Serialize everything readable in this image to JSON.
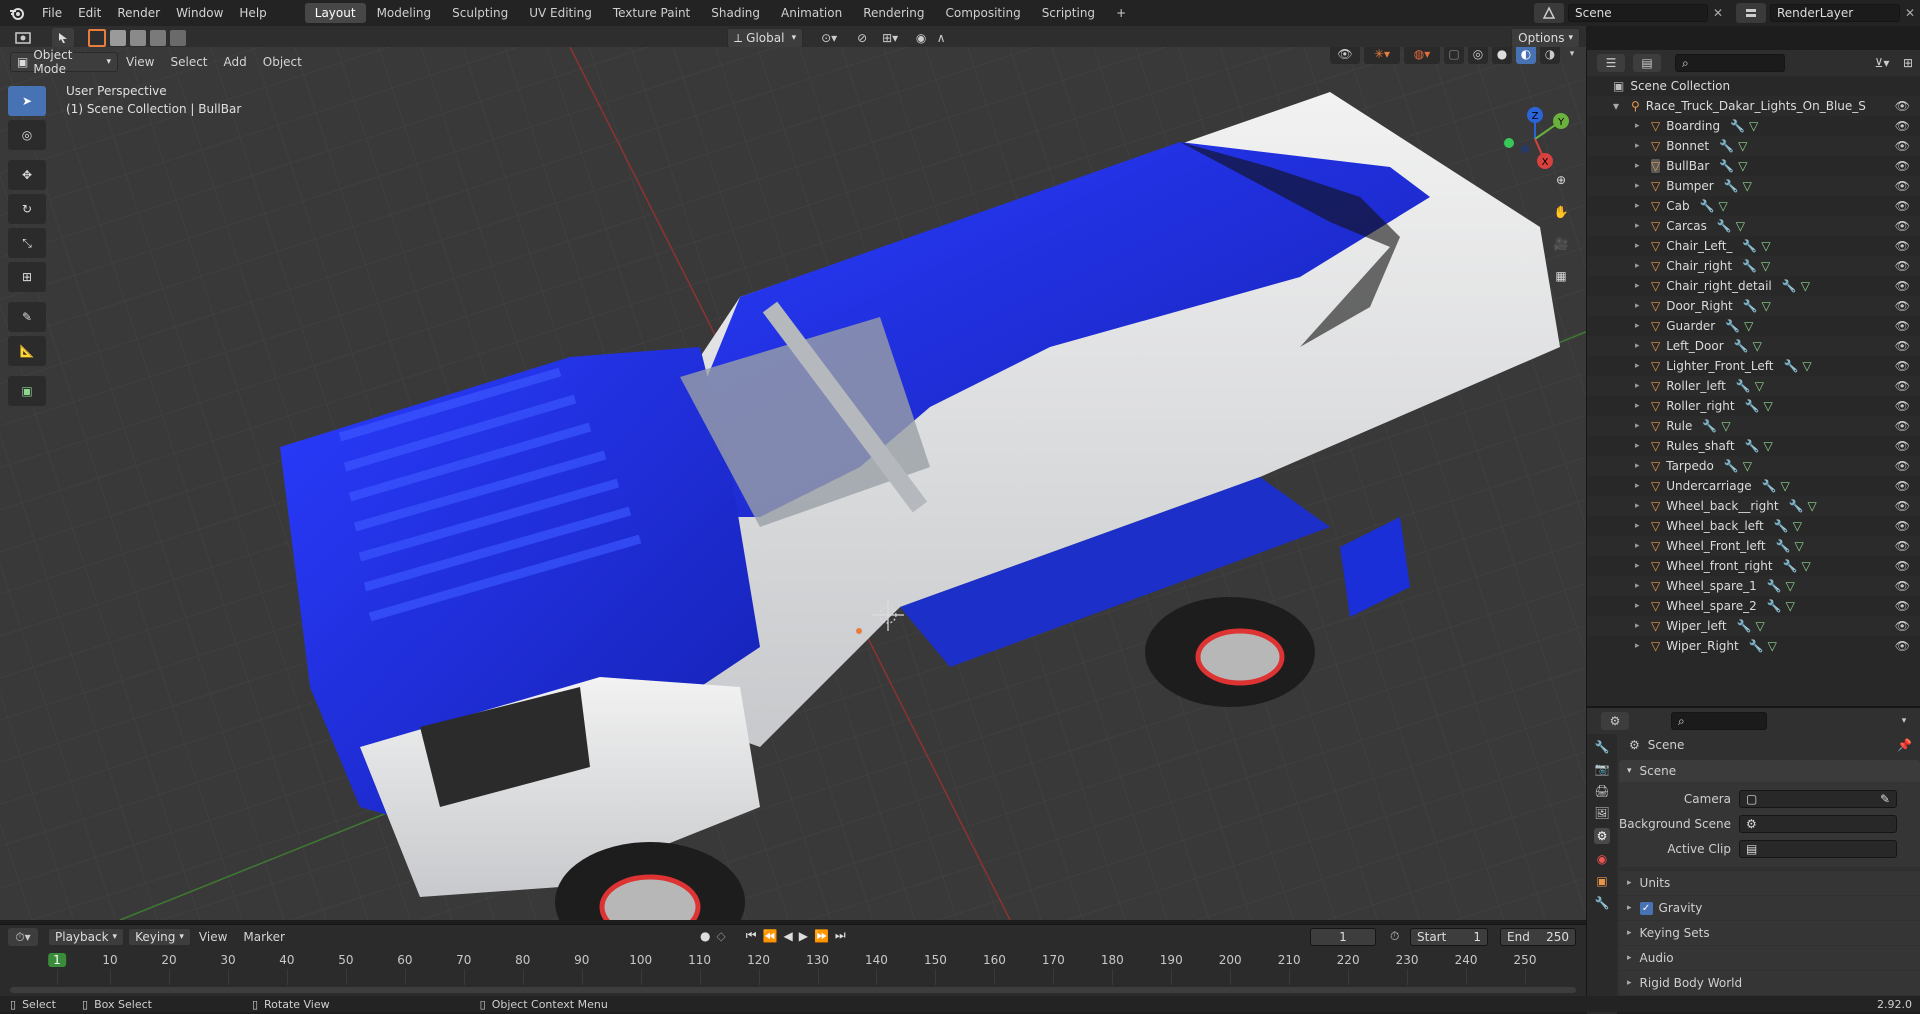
{
  "menubar": {
    "items": [
      "File",
      "Edit",
      "Render",
      "Window",
      "Help"
    ],
    "workspaces": [
      "Layout",
      "Modeling",
      "Sculpting",
      "UV Editing",
      "Texture Paint",
      "Shading",
      "Animation",
      "Rendering",
      "Compositing",
      "Scripting"
    ],
    "active_workspace": "Layout",
    "add_tab": "+",
    "scene_name": "Scene",
    "view_layer": "RenderLayer"
  },
  "viewport_header": {
    "mode": "Object Mode",
    "menus": [
      "View",
      "Select",
      "Add",
      "Object"
    ],
    "orientation": "Global",
    "options": "Options"
  },
  "viewport": {
    "perspective": "User Perspective",
    "collection_info": "(1) Scene Collection | BullBar",
    "gizmo_axes": {
      "x": "X",
      "y": "Y",
      "z": "Z"
    }
  },
  "outliner": {
    "root": "Scene Collection",
    "parent": "Race_Truck_Dakar_Lights_On_Blue_Simple_l",
    "items": [
      "Boarding",
      "Bonnet",
      "BullBar",
      "Bumper",
      "Cab",
      "Carcas",
      "Chair_Left_",
      "Chair_right",
      "Chair_right_detail",
      "Door_Right",
      "Guarder",
      "Left_Door",
      "Lighter_Front_Left",
      "Roller_left",
      "Roller_right",
      "Rule",
      "Rules_shaft",
      "Tarpedo",
      "Undercarriage",
      "Wheel_back__right",
      "Wheel_back_left",
      "Wheel_Front_left",
      "Wheel_front_right",
      "Wheel_spare_1",
      "Wheel_spare_2",
      "Wiper_left",
      "Wiper_Right"
    ],
    "selected": "BullBar"
  },
  "properties": {
    "context": "Scene",
    "panel": "Scene",
    "camera_label": "Camera",
    "background_scene_label": "Background Scene",
    "active_clip_label": "Active Clip",
    "sections": [
      "Units",
      "Gravity",
      "Keying Sets",
      "Audio",
      "Rigid Body World"
    ],
    "gravity_checked": true
  },
  "timeline": {
    "menus": [
      "Playback",
      "Keying",
      "View",
      "Marker"
    ],
    "current_frame": "1",
    "start_label": "Start",
    "start": "1",
    "end_label": "End",
    "end": "250",
    "ticks": [
      "1",
      "10",
      "20",
      "30",
      "40",
      "50",
      "60",
      "70",
      "80",
      "90",
      "100",
      "110",
      "120",
      "130",
      "140",
      "150",
      "160",
      "170",
      "180",
      "190",
      "200",
      "210",
      "220",
      "230",
      "240",
      "250"
    ]
  },
  "statusbar": {
    "select": "Select",
    "box_select": "Box Select",
    "rotate_view": "Rotate View",
    "context_menu": "Object Context Menu",
    "version": "2.92.0"
  },
  "colors": {
    "accent": "#4772b3",
    "outliner_object": "#e8974a",
    "frame_marker": "#3a8b3a",
    "truck_blue": "#1a2fd8",
    "truck_white": "#e6e8ea"
  }
}
